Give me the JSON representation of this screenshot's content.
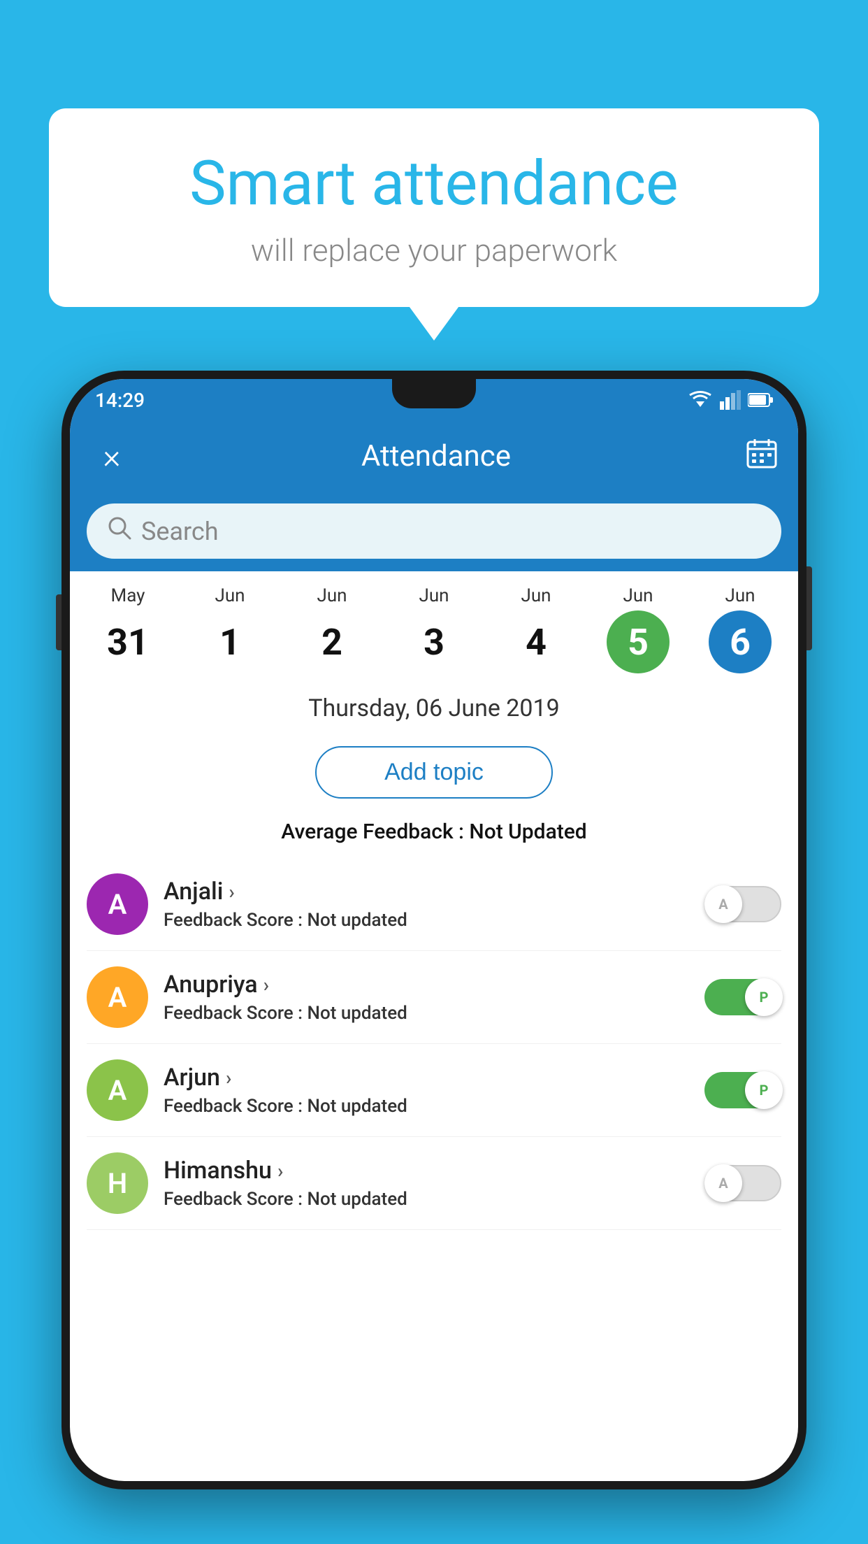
{
  "background_color": "#29b6e8",
  "speech_bubble": {
    "title": "Smart attendance",
    "subtitle": "will replace your paperwork"
  },
  "status_bar": {
    "time": "14:29"
  },
  "app_bar": {
    "title": "Attendance",
    "close_label": "×",
    "calendar_label": "📅"
  },
  "search": {
    "placeholder": "Search"
  },
  "calendar": {
    "days": [
      {
        "month": "May",
        "date": "31",
        "style": "normal"
      },
      {
        "month": "Jun",
        "date": "1",
        "style": "normal"
      },
      {
        "month": "Jun",
        "date": "2",
        "style": "normal"
      },
      {
        "month": "Jun",
        "date": "3",
        "style": "normal"
      },
      {
        "month": "Jun",
        "date": "4",
        "style": "normal"
      },
      {
        "month": "Jun",
        "date": "5",
        "style": "green"
      },
      {
        "month": "Jun",
        "date": "6",
        "style": "blue"
      }
    ],
    "selected_date": "Thursday, 06 June 2019"
  },
  "add_topic_label": "Add topic",
  "feedback_summary": {
    "label": "Average Feedback : ",
    "value": "Not Updated"
  },
  "students": [
    {
      "name": "Anjali",
      "initial": "A",
      "avatar_color": "#9c27b0",
      "feedback_label": "Feedback Score : ",
      "feedback_value": "Not updated",
      "toggle_state": "off",
      "toggle_letter": "A"
    },
    {
      "name": "Anupriya",
      "initial": "A",
      "avatar_color": "#ffa726",
      "feedback_label": "Feedback Score : ",
      "feedback_value": "Not updated",
      "toggle_state": "on",
      "toggle_letter": "P"
    },
    {
      "name": "Arjun",
      "initial": "A",
      "avatar_color": "#8bc34a",
      "feedback_label": "Feedback Score : ",
      "feedback_value": "Not updated",
      "toggle_state": "on",
      "toggle_letter": "P"
    },
    {
      "name": "Himanshu",
      "initial": "H",
      "avatar_color": "#9ccc65",
      "feedback_label": "Feedback Score : ",
      "feedback_value": "Not updated",
      "toggle_state": "off",
      "toggle_letter": "A"
    }
  ]
}
